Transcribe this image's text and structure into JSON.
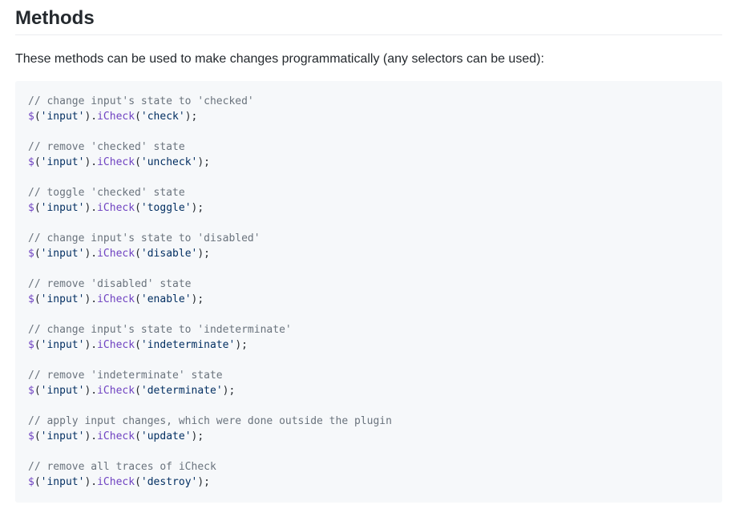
{
  "section": {
    "title": "Methods",
    "intro": "These methods can be used to make changes programmatically (any selectors can be used):"
  },
  "code": {
    "groups": [
      {
        "comment": "// change input's state to 'checked'",
        "selector": "'input'",
        "method": "iCheck",
        "arg": "'check'"
      },
      {
        "comment": "// remove 'checked' state",
        "selector": "'input'",
        "method": "iCheck",
        "arg": "'uncheck'"
      },
      {
        "comment": "// toggle 'checked' state",
        "selector": "'input'",
        "method": "iCheck",
        "arg": "'toggle'"
      },
      {
        "comment": "// change input's state to 'disabled'",
        "selector": "'input'",
        "method": "iCheck",
        "arg": "'disable'"
      },
      {
        "comment": "// remove 'disabled' state",
        "selector": "'input'",
        "method": "iCheck",
        "arg": "'enable'"
      },
      {
        "comment": "// change input's state to 'indeterminate'",
        "selector": "'input'",
        "method": "iCheck",
        "arg": "'indeterminate'"
      },
      {
        "comment": "// remove 'indeterminate' state",
        "selector": "'input'",
        "method": "iCheck",
        "arg": "'determinate'"
      },
      {
        "comment": "// apply input changes, which were done outside the plugin",
        "selector": "'input'",
        "method": "iCheck",
        "arg": "'update'"
      },
      {
        "comment": "// remove all traces of iCheck",
        "selector": "'input'",
        "method": "iCheck",
        "arg": "'destroy'"
      }
    ]
  },
  "colors": {
    "comment": "#6a737d",
    "function": "#6f42c1",
    "string": "#032f62",
    "code_background": "#f6f8fa"
  }
}
